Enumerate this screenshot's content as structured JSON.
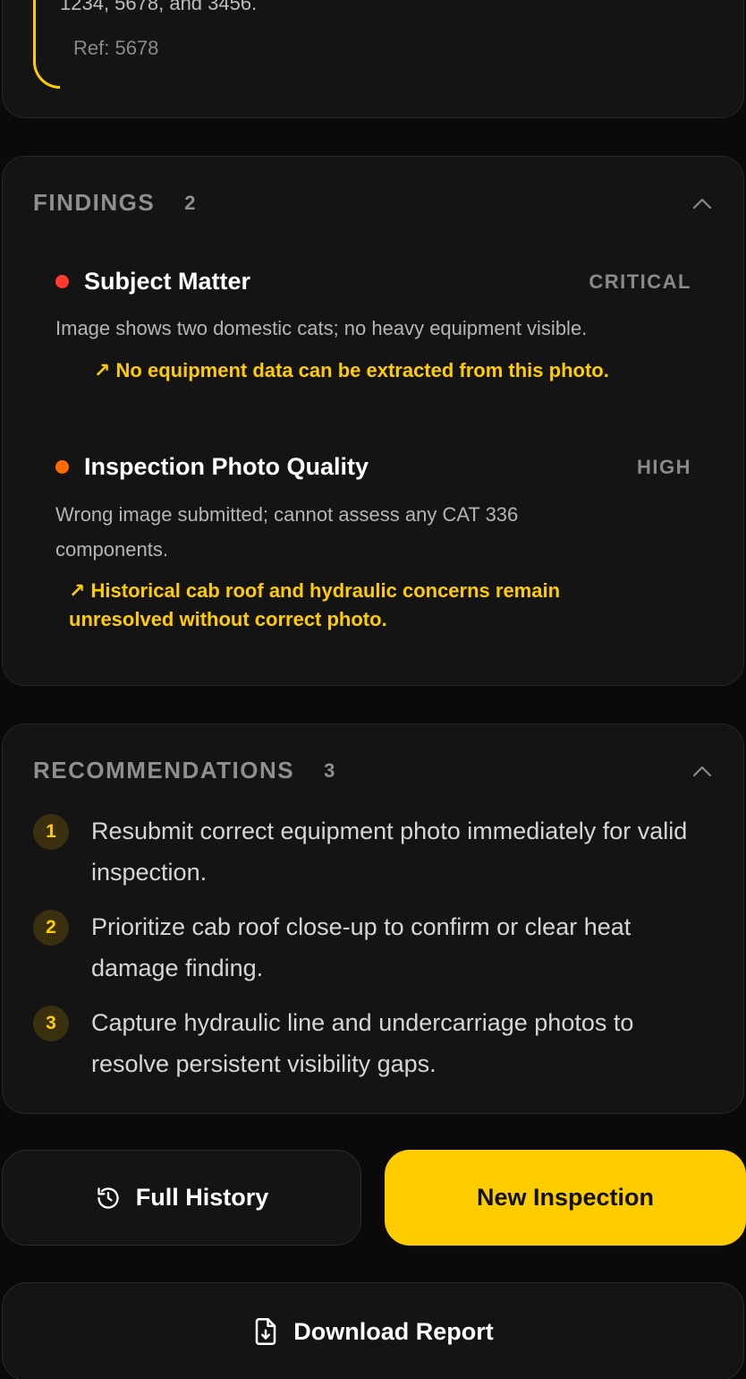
{
  "reference": {
    "previous_text": "1234, 5678, and 3456.",
    "ref_label": "Ref: 5678"
  },
  "findings": {
    "title": "FINDINGS",
    "count": "2",
    "items": [
      {
        "title": "Subject Matter",
        "severity": "CRITICAL",
        "dot_color": "#ff3b30",
        "description": "Image shows two domestic cats; no heavy equipment visible.",
        "impact": "↗ No equipment data can be extracted from this photo."
      },
      {
        "title": "Inspection Photo Quality",
        "severity": "HIGH",
        "dot_color": "#ff6a00",
        "description": "Wrong image submitted; cannot assess any CAT 336 components.",
        "impact": "↗ Historical cab roof and hydraulic concerns remain unresolved without correct photo."
      }
    ]
  },
  "recommendations": {
    "title": "RECOMMENDATIONS",
    "count": "3",
    "items": [
      {
        "number": "1",
        "text": "Resubmit correct equipment photo immediately for valid inspection."
      },
      {
        "number": "2",
        "text": "Prioritize cab roof close-up to confirm or clear heat damage finding."
      },
      {
        "number": "3",
        "text": "Capture hydraulic line and undercarriage photos to resolve persistent visibility gaps."
      }
    ]
  },
  "actions": {
    "full_history": "Full History",
    "new_inspection": "New Inspection",
    "download_report": "Download Report"
  },
  "colors": {
    "accent": "#ffcc00",
    "critical": "#ff3b30",
    "high": "#ff6a00",
    "background": "#0a0a0a",
    "card": "#141414"
  },
  "icons": {
    "history": "history-icon",
    "download": "file-download-icon",
    "collapse": "chevron-up-icon"
  }
}
